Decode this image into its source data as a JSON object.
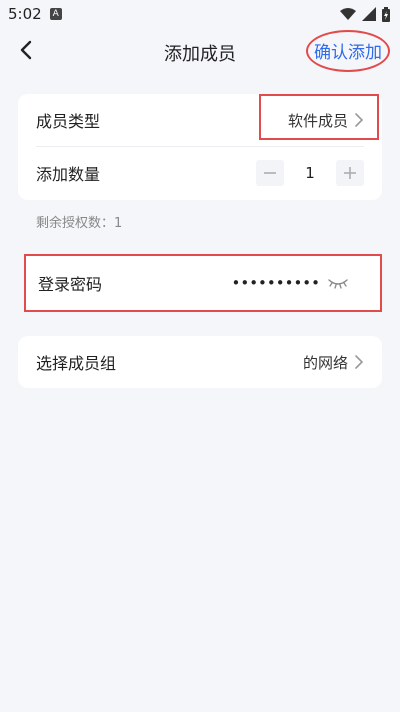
{
  "status_bar": {
    "time": "5:02",
    "notification_letter": "A"
  },
  "nav": {
    "title": "添加成员",
    "confirm_label": "确认添加"
  },
  "form": {
    "member_type": {
      "label": "成员类型",
      "value": "软件成员"
    },
    "quantity": {
      "label": "添加数量",
      "value": "1",
      "minus": "−",
      "plus": "+"
    },
    "remaining": "剩余授权数：1",
    "password": {
      "label": "登录密码",
      "value": "••••••••••"
    },
    "member_group": {
      "label": "选择成员组",
      "value": "的网络"
    }
  },
  "colors": {
    "accent": "#2f6bea",
    "highlight": "#e24b4b",
    "background": "#f5f6fa"
  }
}
